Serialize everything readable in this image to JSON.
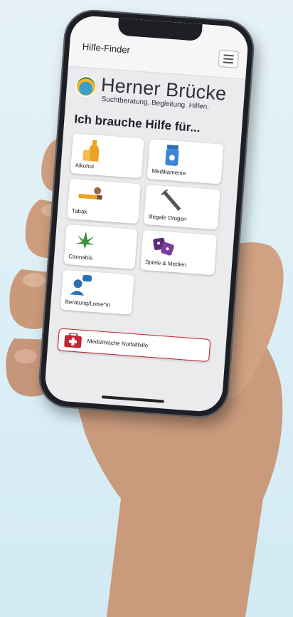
{
  "app": {
    "title": "Hilfe-Finder",
    "brand_name": "Herner Brücke",
    "brand_tagline": "Suchtberatung. Begleitung. Hilfen.",
    "heading": "Ich brauche Hilfe für..."
  },
  "categories": [
    {
      "label": "Alkohol",
      "icon": "bottle-icon"
    },
    {
      "label": "Medikamente",
      "icon": "pill-bottle-icon"
    },
    {
      "label": "Tabak",
      "icon": "cigarette-icon"
    },
    {
      "label": "Illegale Drogen",
      "icon": "syringe-icon"
    },
    {
      "label": "Cannabis",
      "icon": "cannabis-leaf-icon"
    },
    {
      "label": "Spiele & Medien",
      "icon": "dice-gamepad-icon"
    },
    {
      "label": "Beratung/Lotse*in",
      "icon": "counselor-speech-icon"
    }
  ],
  "emergency": {
    "label": "Medizinische Notfallhilfe",
    "icon": "first-aid-kit-icon"
  },
  "colors": {
    "background": "#dbeef6",
    "accent_blue": "#2f6fb6",
    "accent_gold": "#e9a320",
    "accent_green": "#3b8f3e",
    "accent_purple": "#5b2d7a",
    "emergency_red": "#c82333"
  }
}
